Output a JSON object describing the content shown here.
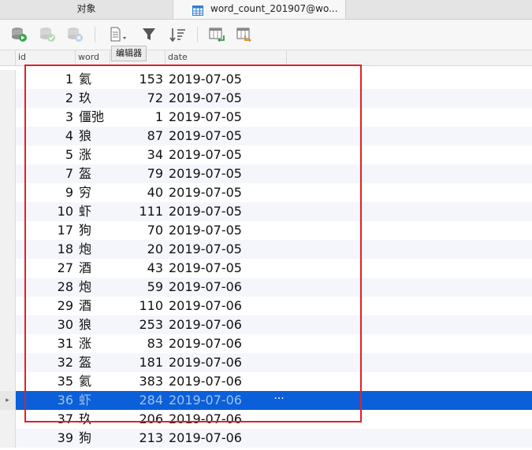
{
  "tabs": {
    "objects_label": "对象",
    "table_label": "word_count_201907@wo..."
  },
  "toolbar": {
    "tooltip": "编辑器"
  },
  "columns": {
    "id": "id",
    "word": "word",
    "count": "",
    "date": "date"
  },
  "rows": [
    {
      "id": "1",
      "word": "氦",
      "count": "153",
      "date": "2019-07-05"
    },
    {
      "id": "2",
      "word": "玖",
      "count": "72",
      "date": "2019-07-05"
    },
    {
      "id": "3",
      "word": "僵弛",
      "count": "1",
      "date": "2019-07-05"
    },
    {
      "id": "4",
      "word": "狼",
      "count": "87",
      "date": "2019-07-05"
    },
    {
      "id": "5",
      "word": "涨",
      "count": "34",
      "date": "2019-07-05"
    },
    {
      "id": "7",
      "word": "盔",
      "count": "79",
      "date": "2019-07-05"
    },
    {
      "id": "9",
      "word": "穷",
      "count": "40",
      "date": "2019-07-05"
    },
    {
      "id": "10",
      "word": "虾",
      "count": "111",
      "date": "2019-07-05"
    },
    {
      "id": "17",
      "word": "狗",
      "count": "70",
      "date": "2019-07-05"
    },
    {
      "id": "18",
      "word": "炮",
      "count": "20",
      "date": "2019-07-05"
    },
    {
      "id": "27",
      "word": "酒",
      "count": "43",
      "date": "2019-07-05"
    },
    {
      "id": "28",
      "word": "炮",
      "count": "59",
      "date": "2019-07-06"
    },
    {
      "id": "29",
      "word": "酒",
      "count": "110",
      "date": "2019-07-06"
    },
    {
      "id": "30",
      "word": "狼",
      "count": "253",
      "date": "2019-07-06"
    },
    {
      "id": "31",
      "word": "涨",
      "count": "83",
      "date": "2019-07-06"
    },
    {
      "id": "32",
      "word": "盔",
      "count": "181",
      "date": "2019-07-06"
    },
    {
      "id": "35",
      "word": "氦",
      "count": "383",
      "date": "2019-07-06"
    },
    {
      "id": "36",
      "word": "虾",
      "count": "284",
      "date": "2019-07-06"
    },
    {
      "id": "37",
      "word": "玖",
      "count": "206",
      "date": "2019-07-06"
    },
    {
      "id": "39",
      "word": "狗",
      "count": "213",
      "date": "2019-07-06"
    }
  ],
  "selected_row_more": "···",
  "colors": {
    "selection": "#0b5fd8",
    "highlight_box": "#e0202a"
  }
}
